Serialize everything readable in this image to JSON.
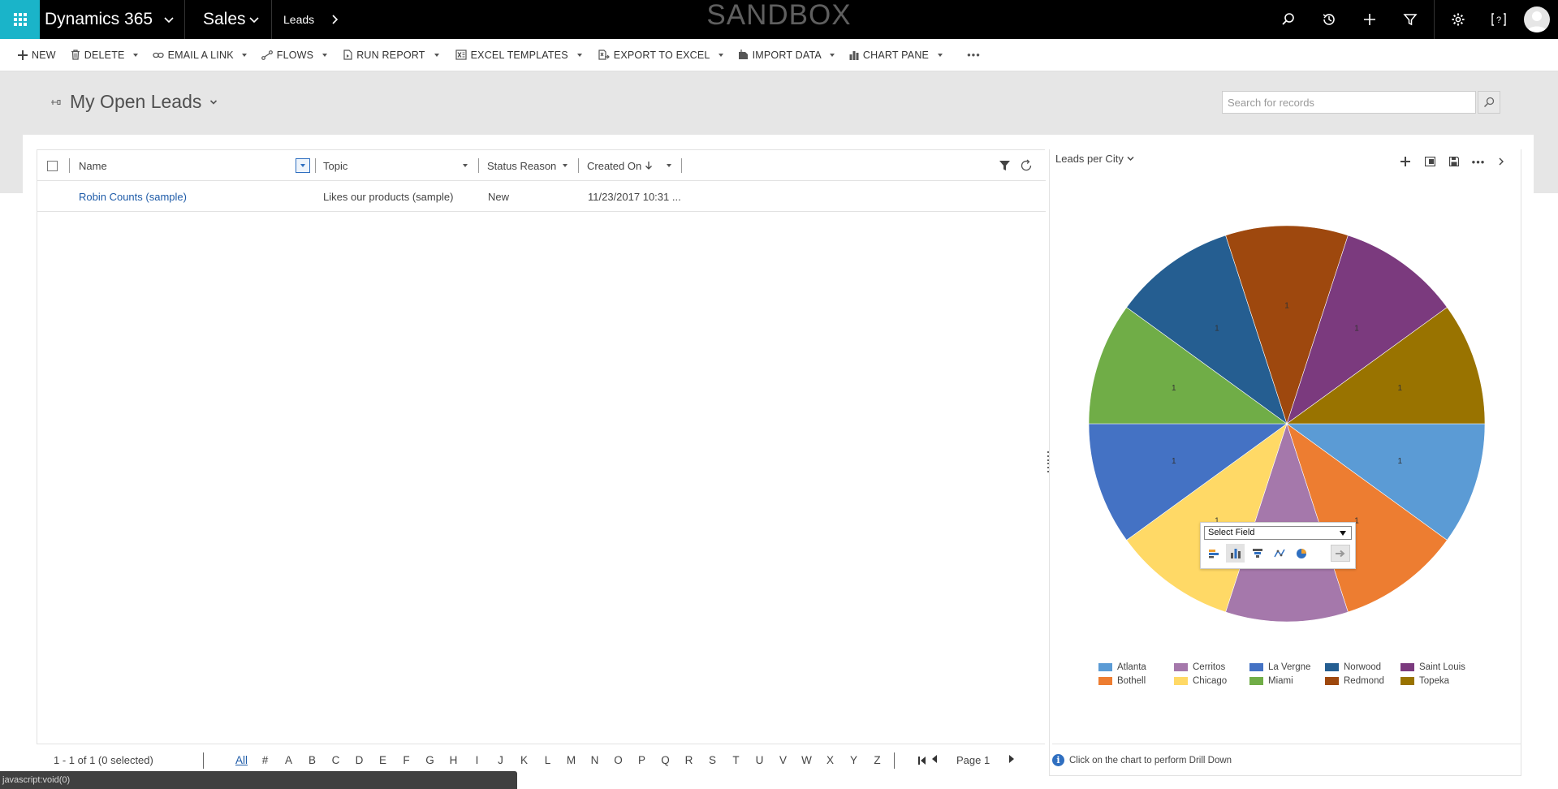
{
  "topnav": {
    "app_name": "Dynamics 365",
    "module": "Sales",
    "breadcrumb": "Leads",
    "environment": "SANDBOX"
  },
  "commands": {
    "new": "NEW",
    "delete": "DELETE",
    "email_link": "EMAIL A LINK",
    "flows": "FLOWS",
    "run_report": "RUN REPORT",
    "excel_templates": "EXCEL TEMPLATES",
    "export_excel": "EXPORT TO EXCEL",
    "import_data": "IMPORT DATA",
    "chart_pane": "CHART PANE",
    "more": "•••"
  },
  "view": {
    "title": "My Open Leads",
    "search_placeholder": "Search for records"
  },
  "grid": {
    "columns": {
      "name": "Name",
      "topic": "Topic",
      "status_reason": "Status Reason",
      "created_on": "Created On"
    },
    "rows": [
      {
        "name": "Robin Counts (sample)",
        "topic": "Likes our products (sample)",
        "status": "New",
        "created": "11/23/2017 10:31 ..."
      }
    ],
    "footer": {
      "count": "1 - 1 of 1 (0 selected)",
      "letters": [
        "All",
        "#",
        "A",
        "B",
        "C",
        "D",
        "E",
        "F",
        "G",
        "H",
        "I",
        "J",
        "K",
        "L",
        "M",
        "N",
        "O",
        "P",
        "Q",
        "R",
        "S",
        "T",
        "U",
        "V",
        "W",
        "X",
        "Y",
        "Z"
      ],
      "page": "Page 1"
    }
  },
  "chart": {
    "header": "Leads per City",
    "info": "Click on the chart to perform Drill Down",
    "drill_select": "Select Field"
  },
  "chart_data": {
    "type": "pie",
    "title": "",
    "slices": [
      {
        "name": "Atlanta",
        "value": 1,
        "color": "#5b9bd5"
      },
      {
        "name": "Bothell",
        "value": 1,
        "color": "#ed7d31"
      },
      {
        "name": "Cerritos",
        "value": 1,
        "color": "#a578ab"
      },
      {
        "name": "Chicago",
        "value": 1,
        "color": "#ffd966"
      },
      {
        "name": "La Vergne",
        "value": 1,
        "color": "#4472c4"
      },
      {
        "name": "Miami",
        "value": 1,
        "color": "#70ad47"
      },
      {
        "name": "Norwood",
        "value": 1,
        "color": "#255e91"
      },
      {
        "name": "Redmond",
        "value": 1,
        "color": "#9e480e"
      },
      {
        "name": "Saint Louis",
        "value": 1,
        "color": "#7b3a7e"
      },
      {
        "name": "Topeka",
        "value": 1,
        "color": "#997300"
      }
    ],
    "legend_placement": "bottom"
  },
  "status": {
    "text": "javascript:void(0)"
  }
}
